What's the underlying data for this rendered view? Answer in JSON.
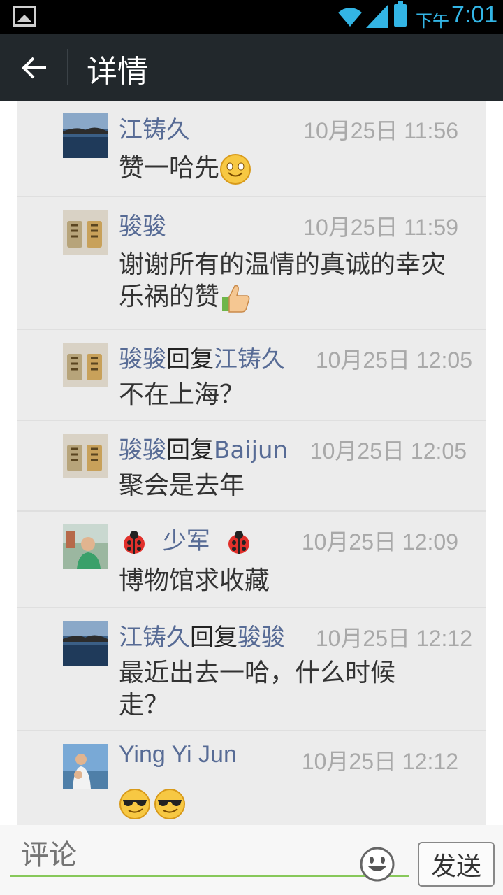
{
  "status_bar": {
    "ampm": "下午",
    "time": "7:01",
    "icons": [
      "image-icon",
      "wifi-icon",
      "signal-icon",
      "battery-icon"
    ]
  },
  "action_bar": {
    "title": "详情",
    "back_icon": "arrow-left-icon"
  },
  "comments": [
    {
      "name": "江铸久",
      "reply_label": "",
      "reply_to": "",
      "time": "10月25日 11:56",
      "text": "赞一哈先",
      "emojis": [
        "smile-emoji"
      ],
      "avatar": "lake-photo"
    },
    {
      "name": "骏骏",
      "reply_label": "",
      "reply_to": "",
      "time": "10月25日 11:59",
      "text": "谢谢所有的温情的真诚的幸灾乐祸的赞",
      "emojis": [
        "thumbs-up-emoji"
      ],
      "avatar": "keychain-photo"
    },
    {
      "name": "骏骏",
      "reply_label": "回复",
      "reply_to": "江铸久",
      "time": "10月25日 12:05",
      "text": "不在上海？",
      "emojis": [],
      "avatar": "keychain-photo"
    },
    {
      "name": "骏骏",
      "reply_label": "回复",
      "reply_to": "Baijun",
      "time": "10月25日 12:05",
      "text": "聚会是去年",
      "emojis": [],
      "avatar": "keychain-photo"
    },
    {
      "name": "少军",
      "reply_label": "",
      "reply_to": "",
      "time": "10月25日 12:09",
      "text": "博物馆求收藏",
      "emojis": [],
      "avatar": "man-photo",
      "name_decor": "ladybug-emoji"
    },
    {
      "name": "江铸久",
      "reply_label": "回复",
      "reply_to": "骏骏",
      "time": "10月25日 12:12",
      "text": "最近出去一哈，什么时候走？",
      "emojis": [],
      "avatar": "lake-photo"
    },
    {
      "name": "Ying Yi Jun",
      "reply_label": "",
      "reply_to": "",
      "time": "10月25日 12:12",
      "text": "",
      "emojis": [
        "sunglasses-emoji",
        "sunglasses-emoji"
      ],
      "avatar": "child-photo"
    }
  ],
  "input_bar": {
    "placeholder": "评论",
    "send_label": "发送",
    "smile_icon": "smiley-face-icon"
  },
  "colors": {
    "status_bar_bg": "#000000",
    "action_bar_bg": "#22282c",
    "name": "#576b95",
    "time": "#a9a9a9",
    "content_bg": "#ececec",
    "input_underline": "#87c85a"
  }
}
